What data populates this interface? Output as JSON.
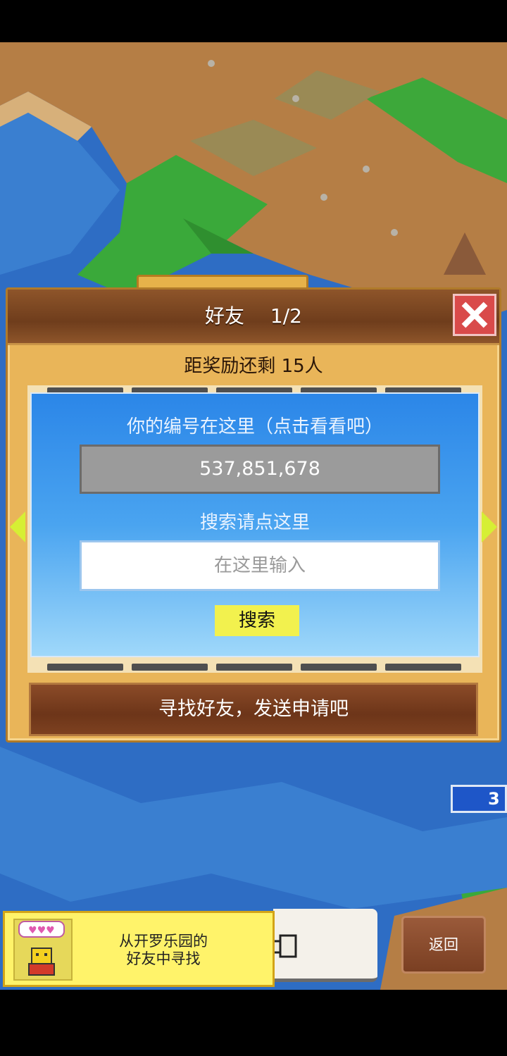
{
  "dialog": {
    "title": "好友　 1/2",
    "reward_text": "距奖励还剩 15人",
    "id_caption": "你的编号在这里（点击看看吧）",
    "player_id": "537,851,678",
    "search_caption": "搜索请点这里",
    "search_placeholder": "在这里输入",
    "search_button": "搜索",
    "send_request_button": "寻找好友，发送申请吧"
  },
  "side": {
    "count": "3"
  },
  "bottom": {
    "kairo_line1": "从开罗乐园的",
    "kairo_line2": "好友中寻找",
    "return_button": "返回"
  },
  "colors": {
    "dialog_bg": "#e9b559",
    "header": "#6f3d1c",
    "panel_top": "#2b86e8",
    "panel_bottom": "#9fd8fa",
    "search_button": "#f2f14e",
    "close_button": "#d94a4a"
  }
}
